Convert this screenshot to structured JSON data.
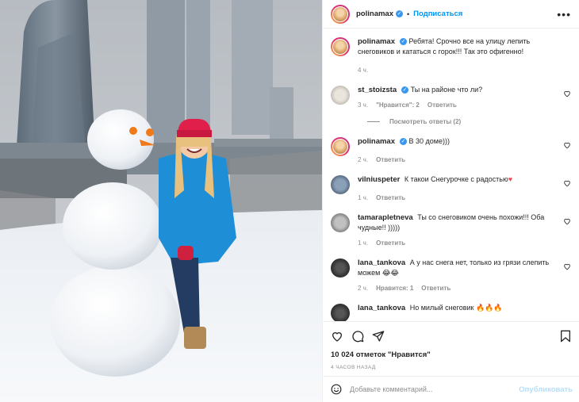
{
  "header": {
    "username": "polinamax",
    "separator": "•",
    "follow_label": "Подписаться",
    "more_label": "•••"
  },
  "caption": {
    "username": "polinamax",
    "text": "Ребята! Срочно все на улицу лепить снеговиков и кататься с горок!!! Так это офигенно!",
    "time": "4 ч."
  },
  "comments": [
    {
      "username": "st_stoizsta",
      "verified": true,
      "text": "Ты на районе что ли?",
      "time": "3 ч.",
      "likes": "\"Нравится\": 2",
      "reply": "Ответить"
    },
    {
      "username": "polinamax",
      "verified": true,
      "text": "В 30 доме)))",
      "time": "2 ч.",
      "reply": "Ответить"
    },
    {
      "username": "vilniuspeter",
      "text": "К такои Снегурочке с радостью",
      "emoji": "♥",
      "time": "1 ч.",
      "reply": "Ответить"
    },
    {
      "username": "tamarapletneva",
      "text": "Ты со снеговиком очень похожи!!! Оба чудные!! )))))",
      "time": "1 ч.",
      "reply": "Ответить"
    },
    {
      "username": "lana_tankova",
      "text": "А у нас снега нет, только из грязи слепить можем",
      "emoji": "😂😂",
      "time": "2 ч.",
      "likes": "Нравится: 1",
      "reply": "Ответить"
    },
    {
      "username": "lana_tankova",
      "text": "Но милый снеговик",
      "emoji": "🔥🔥🔥"
    }
  ],
  "view_replies": "Посмотреть ответы (2)",
  "likes_text": "10 024 отметок \"Нравится\"",
  "post_time": "4 ЧАСОВ НАЗАД",
  "add_comment": {
    "placeholder": "Добавьте комментарий...",
    "publish_label": "Опубликовать"
  },
  "colors": {
    "accent": "#0095f6",
    "verified": "#3897f0",
    "muted": "#8e8e8e",
    "publish_disabled": "#b2dffc",
    "jacket": "#1e8fd6",
    "hat": "#e0204a"
  },
  "icons": [
    "heart-icon",
    "comment-icon",
    "share-icon",
    "bookmark-icon",
    "emoji-icon",
    "more-icon",
    "verified-icon"
  ]
}
